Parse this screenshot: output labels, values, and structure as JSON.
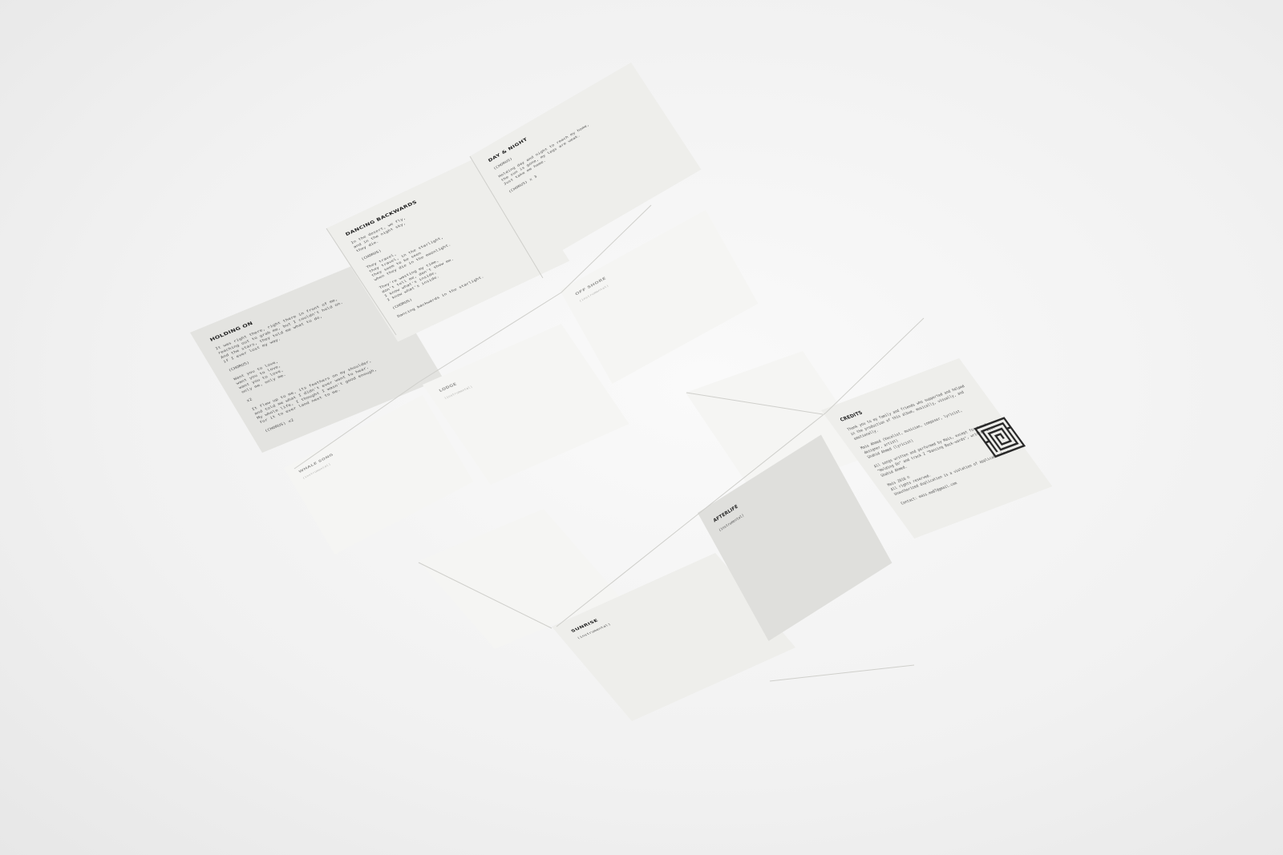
{
  "panels": {
    "holding_on": {
      "title": "HOLDING ON",
      "body": "It was right there, right there in front of me,\nreaching out to grab me, but I couldn't hold on.\nAnd the stars, they told me what to do,\nif I ever lost my way.\n\n(CHORUS)\n\nWant you to love,\nwant you to love,\nwant you to love,\nonly me, only me.\n\nx2\n\nIt flew up to me, its feathers on my shoulder,\nand told me what I didn't ever want to hear.\nMy whole life, I thought I wasn't good enough,\nfor it to ever land next to me.\n\n(CHORUS) x2"
    },
    "dancing_backwards": {
      "title": "DANCING BACKWARDS",
      "body": "In the desert, we fly,\nand in the night sky,\nthey die.\n\n(CHORUS)\n\nThey travel,\nthey travel, in the starlight,\nthey seem to be seen\nwhen they die in the moonlight.\n\nThey're wasting my time,\ndon't tell me, don't show me.\nI know what's inside,\nI know what's inside.\n\n(CHORUS)\n\nDancing backwards in the starlight."
    },
    "day_and_night": {
      "title": "DAY & NIGHT",
      "body": "(CHORUS)\n\nHolding day and night to reach my home,\nthe sun is gone, my legs are weak.\nJust take me home.\n\n(CHORUS) x 3"
    },
    "off_shore": {
      "title": "OFF SHORE",
      "subtitle": "(instrumental)"
    },
    "lodge": {
      "title": "LODGE",
      "subtitle": "(instrumental)"
    },
    "whale_song": {
      "title": "WHALE SONG",
      "subtitle": "(instrumental)"
    },
    "sunrise": {
      "title": "SUNRISE",
      "subtitle": "(instrumental)"
    },
    "afterlife": {
      "title": "AFTERLIFE",
      "subtitle": "(instrumental)"
    },
    "credits": {
      "title": "CREDITS",
      "body": "Thank you to my family and friends who supported and helped in the production of this album, musically, visually, and emotionally.\n\nMais Ahmed (Vocalist, musician, composer, lyricist, designer, artist)\nShahid Ahmed (lyricist)\n\nAll songs written and performed by Mais, except for track \"Holding On\" and track 2 \"Dancing Back-wards\", written with Shahid Ahmed.\n\nMais 2018 ©\nAll rights reserved.\nUnauthorized duplication is a violation of applicable laws.\n\nContact: mais.ma07@gmail.com"
    }
  },
  "colors": {
    "paper_light": "#f5f5f3",
    "paper_mid": "#eeeeeb",
    "paper_shadow": "#e3e3e0",
    "ink": "#333333"
  },
  "icons": [
    "maze-monogram-logo"
  ]
}
